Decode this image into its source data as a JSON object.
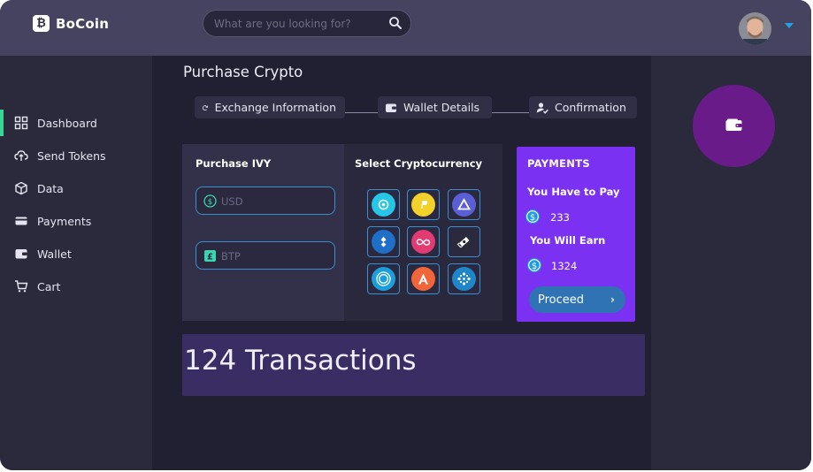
{
  "brand": {
    "logo_letter": "₿",
    "name": "BoCoin"
  },
  "search": {
    "placeholder": "What are you looking for?"
  },
  "sidebar": {
    "items": [
      {
        "label": "Dashboard",
        "icon": "grid-icon",
        "active": true
      },
      {
        "label": "Send Tokens",
        "icon": "cloud-upload-icon"
      },
      {
        "label": "Data",
        "icon": "cube-icon"
      },
      {
        "label": "Payments",
        "icon": "card-icon"
      },
      {
        "label": "Wallet",
        "icon": "wallet-icon"
      },
      {
        "label": "Cart",
        "icon": "cart-icon"
      }
    ]
  },
  "main": {
    "title": "Purchase Crypto",
    "steps": [
      {
        "label": "Exchange Information",
        "icon": "refresh-icon"
      },
      {
        "label": "Wallet Details",
        "icon": "wallet-icon"
      },
      {
        "label": "Confirmation",
        "icon": "user-check-icon"
      }
    ],
    "purchase": {
      "title": "Purchase IVY",
      "usd_placeholder": "USD",
      "btp_placeholder": "BTP"
    },
    "select": {
      "title": "Select Cryptocurrency",
      "coins": [
        "cyan-coin-icon",
        "yellow-coin-icon",
        "triangle-coin-icon",
        "blue-drop-coin-icon",
        "infinity-coin-icon",
        "ticket-coin-icon",
        "ring-coin-icon",
        "orange-a-coin-icon",
        "dots-coin-icon"
      ]
    },
    "payments": {
      "title": "PAYMENTS",
      "have_to_pay_label": "You Have to Pay",
      "have_to_pay_value": "233",
      "will_earn_label": "You Will Earn",
      "will_earn_value": "1324",
      "proceed_label": "Proceed",
      "proceed_chevron": "›"
    },
    "transactions": {
      "text": "124 Transactions"
    }
  },
  "colors": {
    "accent_green": "#3ad694",
    "payments_bg": "#7a31f1",
    "field_border": "#3a8fcf",
    "wallet_circle": "#6a1b8a"
  }
}
